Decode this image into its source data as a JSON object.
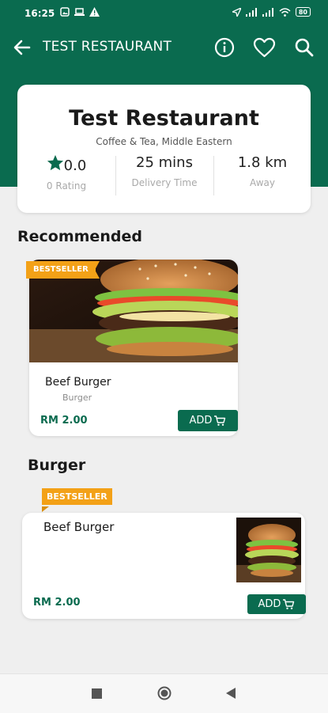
{
  "status_bar": {
    "time": "16:25",
    "battery": "80"
  },
  "topbar": {
    "title": "TEST RESTAURANT"
  },
  "restaurant": {
    "name": "Test Restaurant",
    "cuisine": "Coffee & Tea, Middle Eastern",
    "rating": "0.0",
    "rating_label": "0 Rating",
    "delivery_time": "25 mins",
    "delivery_label": "Delivery Time",
    "distance": "1.8 km",
    "distance_label": "Away"
  },
  "recommended": {
    "title": "Recommended",
    "item": {
      "badge": "BESTSELLER",
      "name": "Beef Burger",
      "category": "Burger",
      "price": "RM 2.00",
      "add_label": "ADD"
    }
  },
  "burger_section": {
    "title": "Burger",
    "item": {
      "badge": "BESTSELLER",
      "name": "Beef Burger",
      "price": "RM 2.00",
      "add_label": "ADD"
    }
  },
  "colors": {
    "primary": "#0a6b4f",
    "badge": "#f3a117",
    "background": "#efefef"
  },
  "icons": [
    "back-arrow-icon",
    "info-icon",
    "heart-icon",
    "search-icon",
    "star-icon",
    "cart-icon",
    "nav-square-icon",
    "nav-circle-icon",
    "nav-back-icon"
  ]
}
